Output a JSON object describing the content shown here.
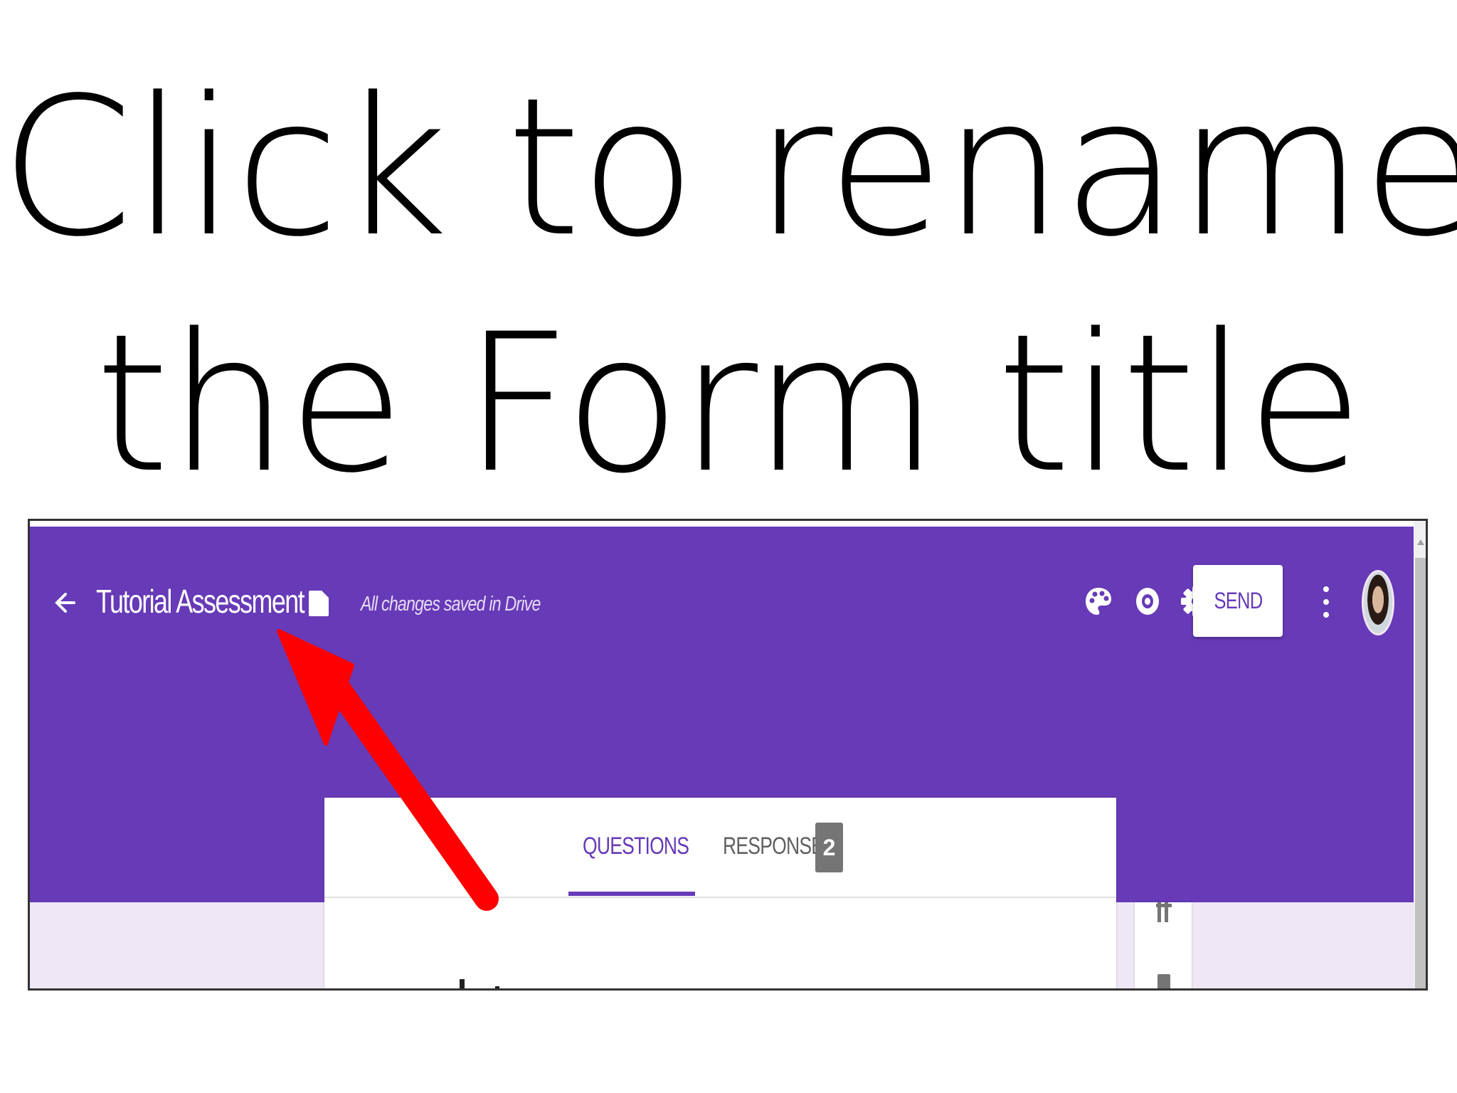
{
  "slide": {
    "heading_line1": "Click to rename",
    "heading_line2": "the Form title"
  },
  "header": {
    "form_title": "Tutorial Assessment",
    "save_status": "All changes saved in Drive",
    "send_label": "SEND",
    "icons": [
      "back-arrow-icon",
      "folder-icon",
      "palette-icon",
      "preview-eye-icon",
      "settings-gear-icon",
      "more-vert-icon"
    ],
    "bar_color": "#673ab7"
  },
  "tabs": {
    "questions_label": "QUESTIONS",
    "responses_label": "RESPONSES",
    "responses_count": "2"
  },
  "annotation": {
    "arrow_color": "#ff0000"
  }
}
